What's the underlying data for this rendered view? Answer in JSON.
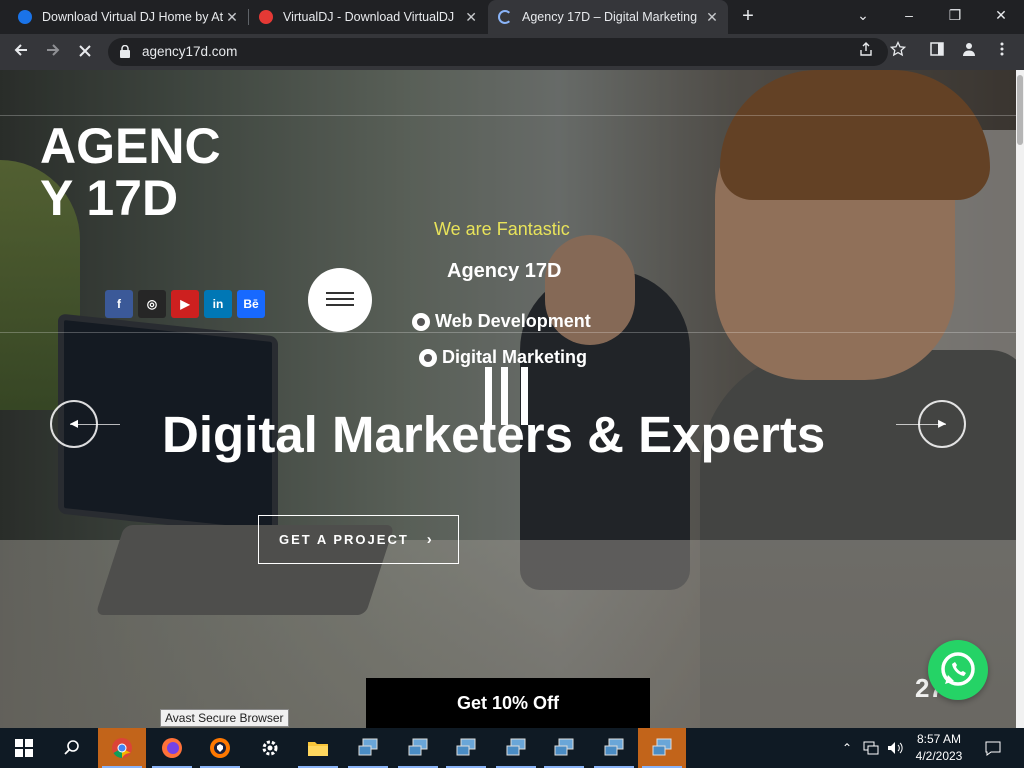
{
  "browser": {
    "tabs": [
      {
        "title": "Download Virtual DJ Home by At",
        "favicon_color": "#1a73e8",
        "active": false
      },
      {
        "title": "VirtualDJ - Download VirtualDJ",
        "favicon_color": "#e53935",
        "active": false
      },
      {
        "title": "Agency 17D – Digital Marketing",
        "favicon_color": "#8ab4f8",
        "active": true
      }
    ],
    "new_tab_glyph": "+",
    "url": "agency17d.com",
    "window_controls": {
      "minimize": "–",
      "restore": "❐",
      "close": "✕",
      "tab_search": "⌄"
    }
  },
  "page": {
    "logo_text": "AGENCY 17D",
    "social": [
      {
        "name": "facebook-icon",
        "glyph": "f",
        "color": "#3b5998"
      },
      {
        "name": "instagram-icon",
        "glyph": "◎",
        "color": "#262626"
      },
      {
        "name": "youtube-icon",
        "glyph": "▶",
        "color": "#cd201f"
      },
      {
        "name": "linkedin-icon",
        "glyph": "in",
        "color": "#0077b5"
      },
      {
        "name": "behance-icon",
        "glyph": "Bē",
        "color": "#1769ff"
      }
    ],
    "tagline": "We are Fantastic",
    "agency_name": "Agency 17D",
    "services": [
      "Web Development",
      "Digital Marketing"
    ],
    "headline": "Digital Marketers & Experts",
    "cta_label": "GET A PROJECT",
    "offer_label": "Get 10% Off",
    "slide_number": "27",
    "tooltip": "Avast Secure Browser",
    "accent_color": "#e8e35a"
  },
  "taskbar": {
    "time": "8:57 AM",
    "date": "4/2/2023"
  }
}
